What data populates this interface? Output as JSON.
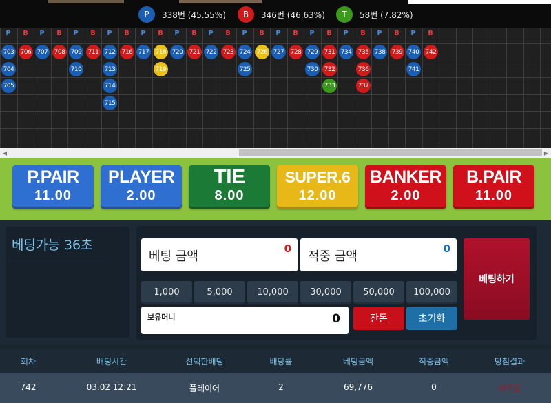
{
  "stats": {
    "player": {
      "icon": "P",
      "text": "338번 (45.55%)",
      "color": "#1a5fb4"
    },
    "banker": {
      "icon": "B",
      "text": "346번 (46.63%)",
      "color": "#d11a1a"
    },
    "tie": {
      "icon": "T",
      "text": "58번 (7.82%)",
      "color": "#3a9a1a"
    }
  },
  "road": {
    "header": [
      "P",
      "B",
      "P",
      "B",
      "P",
      "B",
      "P",
      "B",
      "P",
      "B",
      "P",
      "B",
      "P",
      "B",
      "P",
      "B",
      "P",
      "B",
      "P",
      "B",
      "P",
      "B",
      "P",
      "B",
      "P",
      "B"
    ],
    "columns": [
      [
        {
          "n": "703",
          "c": "P"
        },
        {
          "n": "704",
          "c": "P"
        },
        {
          "n": "705",
          "c": "P"
        }
      ],
      [
        {
          "n": "706",
          "c": "B"
        }
      ],
      [
        {
          "n": "707",
          "c": "P"
        }
      ],
      [
        {
          "n": "708",
          "c": "B"
        }
      ],
      [
        {
          "n": "709",
          "c": "P"
        },
        {
          "n": "710",
          "c": "P"
        }
      ],
      [
        {
          "n": "711",
          "c": "B"
        }
      ],
      [
        {
          "n": "712",
          "c": "P"
        },
        {
          "n": "713",
          "c": "P"
        },
        {
          "n": "714",
          "c": "P"
        },
        {
          "n": "715",
          "c": "P"
        }
      ],
      [
        {
          "n": "716",
          "c": "B"
        }
      ],
      [
        {
          "n": "717",
          "c": "P"
        }
      ],
      [
        {
          "n": "718",
          "c": "T"
        },
        {
          "n": "719",
          "c": "T"
        }
      ],
      [
        {
          "n": "720",
          "c": "P"
        }
      ],
      [
        {
          "n": "721",
          "c": "B"
        }
      ],
      [
        {
          "n": "722",
          "c": "P"
        }
      ],
      [
        {
          "n": "723",
          "c": "B"
        }
      ],
      [
        {
          "n": "724",
          "c": "P"
        },
        {
          "n": "725",
          "c": "P"
        }
      ],
      [
        {
          "n": "726",
          "c": "T"
        }
      ],
      [
        {
          "n": "727",
          "c": "P"
        }
      ],
      [
        {
          "n": "728",
          "c": "B"
        }
      ],
      [
        {
          "n": "729",
          "c": "P"
        },
        {
          "n": "730",
          "c": "P"
        }
      ],
      [
        {
          "n": "731",
          "c": "B"
        },
        {
          "n": "732",
          "c": "B"
        },
        {
          "n": "733",
          "c": "T"
        }
      ],
      [
        {
          "n": "734",
          "c": "P"
        }
      ],
      [
        {
          "n": "735",
          "c": "B"
        },
        {
          "n": "736",
          "c": "B"
        },
        {
          "n": "737",
          "c": "B"
        }
      ],
      [
        {
          "n": "738",
          "c": "P"
        }
      ],
      [
        {
          "n": "739",
          "c": "B"
        }
      ],
      [
        {
          "n": "740",
          "c": "P"
        },
        {
          "n": "741",
          "c": "P"
        }
      ],
      [
        {
          "n": "742",
          "c": "B"
        }
      ]
    ],
    "colors": {
      "P": "#1a5fb4",
      "B": "#d11a1a",
      "T": "#e8c21a",
      "G": "#3a9a1a"
    }
  },
  "bets": [
    {
      "name": "P.PAIR",
      "odds": "11.00",
      "color": "#2f6fd1"
    },
    {
      "name": "PLAYER",
      "odds": "2.00",
      "color": "#2f6fd1"
    },
    {
      "name": "TIE",
      "odds": "8.00",
      "color": "#1a7a36"
    },
    {
      "name": "SUPER.6",
      "odds": "12.00",
      "color": "#e8b818"
    },
    {
      "name": "BANKER",
      "odds": "2.00",
      "color": "#d0101a"
    },
    {
      "name": "B.PAIR",
      "odds": "11.00",
      "color": "#d0101a"
    }
  ],
  "panel": {
    "timer_text": "베팅가능 36초",
    "bet_amount_label": "베팅 금액",
    "bet_amount_value": "0",
    "win_amount_label": "적중 금액",
    "win_amount_value": "0",
    "chips": [
      "1,000",
      "5,000",
      "10,000",
      "30,000",
      "50,000",
      "100,000"
    ],
    "money_label": "보유머니",
    "money_value": "0",
    "change_label": "잔돈",
    "reset_label": "초기화",
    "place_label": "베팅하기"
  },
  "history": {
    "headers": [
      "회차",
      "배팅시간",
      "선택한배팅",
      "배당률",
      "베팅금액",
      "적중금액",
      "당첨결과"
    ],
    "rows": [
      {
        "round": "742",
        "time": "03.02 12:21",
        "choice": "플레이어",
        "odds": "2",
        "amount": "69,776",
        "win": "0",
        "result": "미적중",
        "result_color": "#b3121f"
      }
    ]
  }
}
